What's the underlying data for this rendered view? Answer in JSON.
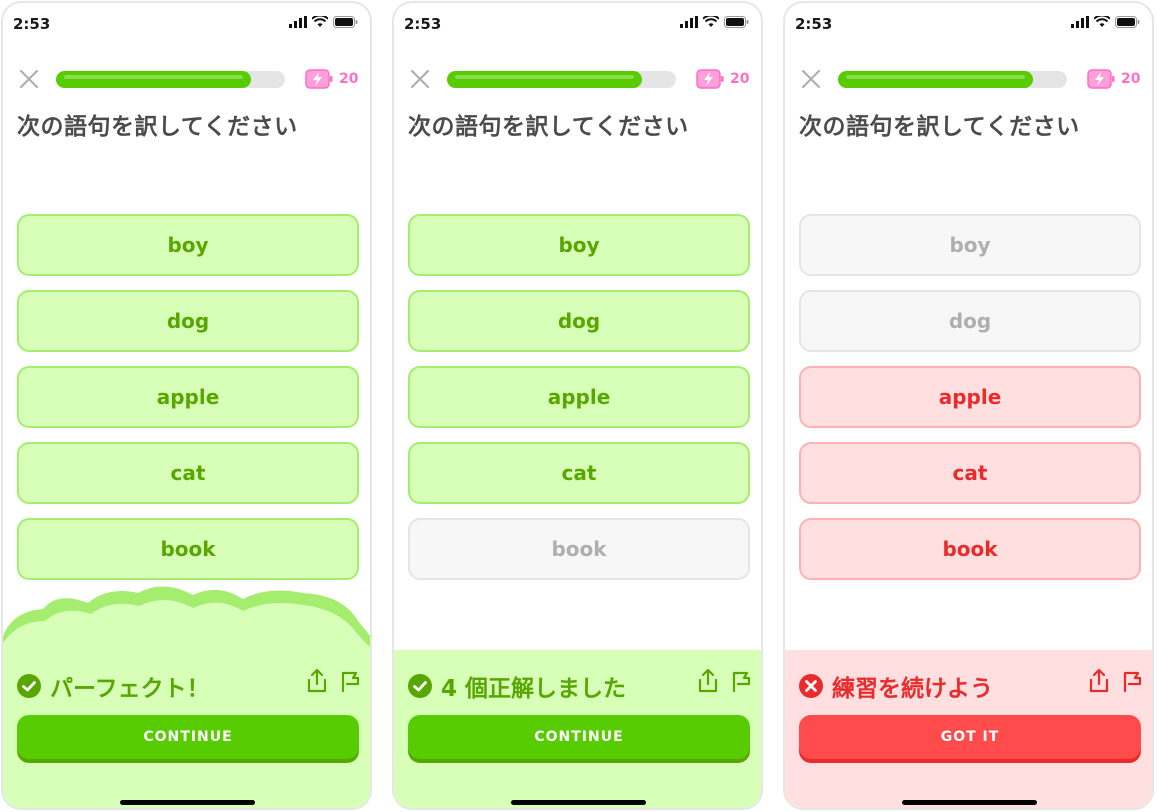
{
  "colors": {
    "green": "#58cc02",
    "red": "#ff4b4b",
    "energy": "#ff6fc4"
  },
  "screens": [
    {
      "status_time": "2:53",
      "progress": 0.85,
      "energy": "20",
      "prompt": "次の語句を訳してください",
      "options": [
        "boy",
        "dog",
        "apple",
        "cat",
        "book"
      ],
      "option_states": [
        "correct",
        "correct",
        "correct",
        "correct",
        "correct"
      ],
      "result_icon": "check-circle-icon",
      "result_text": "パーフェクト！",
      "button_label": "CONTINUE",
      "theme": "green"
    },
    {
      "status_time": "2:53",
      "progress": 0.85,
      "energy": "20",
      "prompt": "次の語句を訳してください",
      "options": [
        "boy",
        "dog",
        "apple",
        "cat",
        "book"
      ],
      "option_states": [
        "correct",
        "correct",
        "correct",
        "correct",
        "missed"
      ],
      "result_icon": "check-circle-icon",
      "result_text": "4 個正解しました",
      "button_label": "CONTINUE",
      "theme": "green"
    },
    {
      "status_time": "2:53",
      "progress": 0.85,
      "energy": "20",
      "prompt": "次の語句を訳してください",
      "options": [
        "boy",
        "dog",
        "apple",
        "cat",
        "book"
      ],
      "option_states": [
        "missed",
        "missed",
        "wrong",
        "wrong",
        "wrong"
      ],
      "result_icon": "x-circle-icon",
      "result_text": "練習を続けよう",
      "button_label": "GOT IT",
      "theme": "red"
    }
  ]
}
